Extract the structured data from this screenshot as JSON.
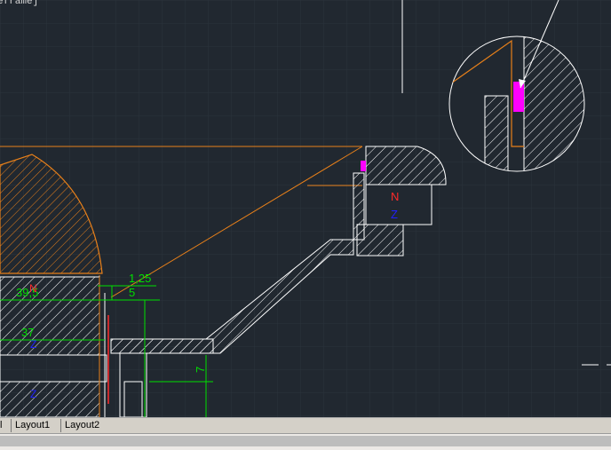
{
  "viewport": {
    "label": "eframe]"
  },
  "tabs": [
    {
      "label": "l"
    },
    {
      "label": "Layout1"
    },
    {
      "label": "Layout2"
    }
  ],
  "drawing": {
    "labels": {
      "N_upper": "N",
      "Z_upper": "Z",
      "dim_1_25": "1,25",
      "dim_5": "5",
      "dim_39_5": "39,5",
      "dim_37": "37",
      "dim_7": "7",
      "N_left": "N",
      "Z_left_1": "Z",
      "Z_left_2": "Z"
    },
    "colors": {
      "background": "#212830",
      "outline": "#ffffff",
      "orange": "#e8801a",
      "dimension": "#00e000",
      "magenta": "#ff00ff",
      "red": "#ff2a2a",
      "blue": "#2020ff"
    }
  }
}
